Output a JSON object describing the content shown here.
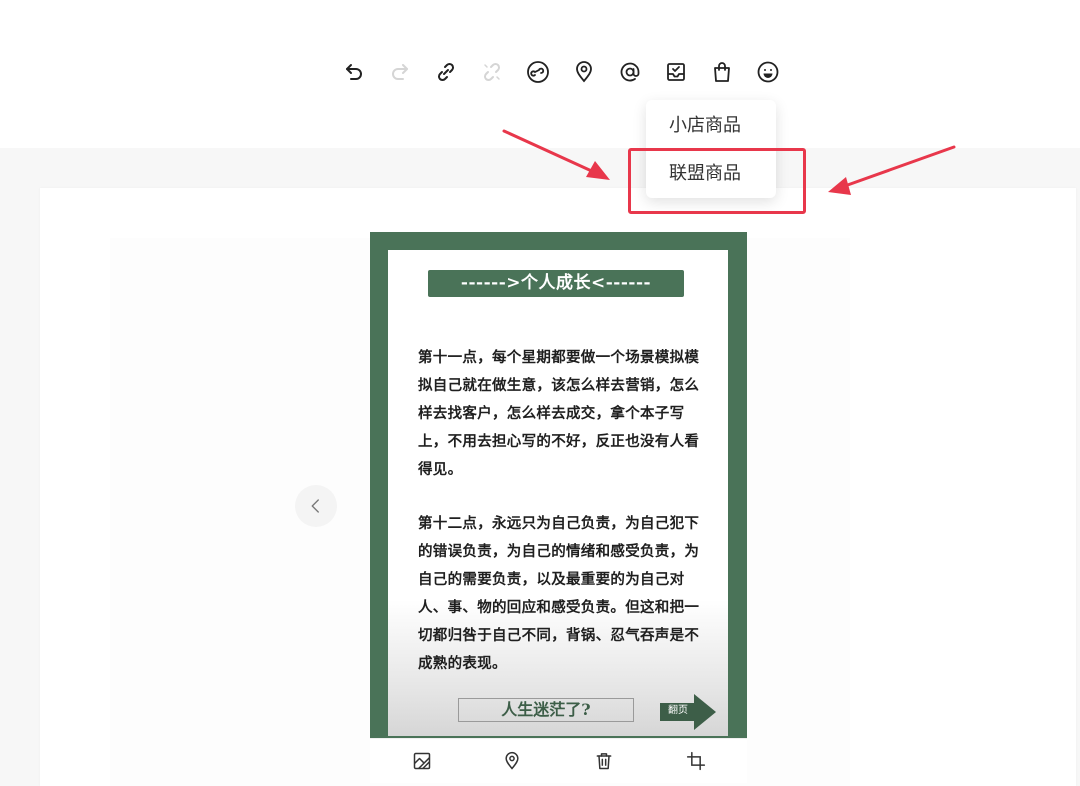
{
  "toolbar": {
    "buttons": [
      {
        "name": "undo-icon",
        "enabled": true
      },
      {
        "name": "redo-icon",
        "enabled": false
      },
      {
        "name": "link-icon",
        "enabled": true
      },
      {
        "name": "unlink-icon",
        "enabled": false
      },
      {
        "name": "mini-program-icon",
        "enabled": true
      },
      {
        "name": "location-icon",
        "enabled": true
      },
      {
        "name": "at-mention-icon",
        "enabled": true
      },
      {
        "name": "inbox-product-icon",
        "enabled": true
      },
      {
        "name": "shopping-bag-icon",
        "enabled": true
      },
      {
        "name": "emoji-icon",
        "enabled": true
      }
    ]
  },
  "dropdown": {
    "items": [
      "小店商品",
      "联盟商品"
    ],
    "highlighted_index": 1
  },
  "post": {
    "title": "------>个人成长<------",
    "paragraph1": "第十一点，每个星期都要做一个场景模拟模拟自己就在做生意，该怎么样去营销，怎么样去找客户，怎么样去成交，拿个本子写上，不用去担心写的不好，反正也没有人看得见。",
    "paragraph2": "第十二点，永远只为自己负责，为自己犯下的错误负责，为自己的情绪和感受负责，为自己的需要负责，以及最重要的为自己对人、事、物的回应和感受负责。但这和把一切都归咎于自己不同，背锅、忍气吞声是不成熟的表现。",
    "footer_text": "人生迷茫了?",
    "page_turn_label": "翻页"
  },
  "image_tools": [
    "image-replace-icon",
    "location-icon",
    "trash-icon",
    "crop-icon"
  ],
  "colors": {
    "post_green": "#4a7358",
    "annotation_red": "#e8374b"
  }
}
